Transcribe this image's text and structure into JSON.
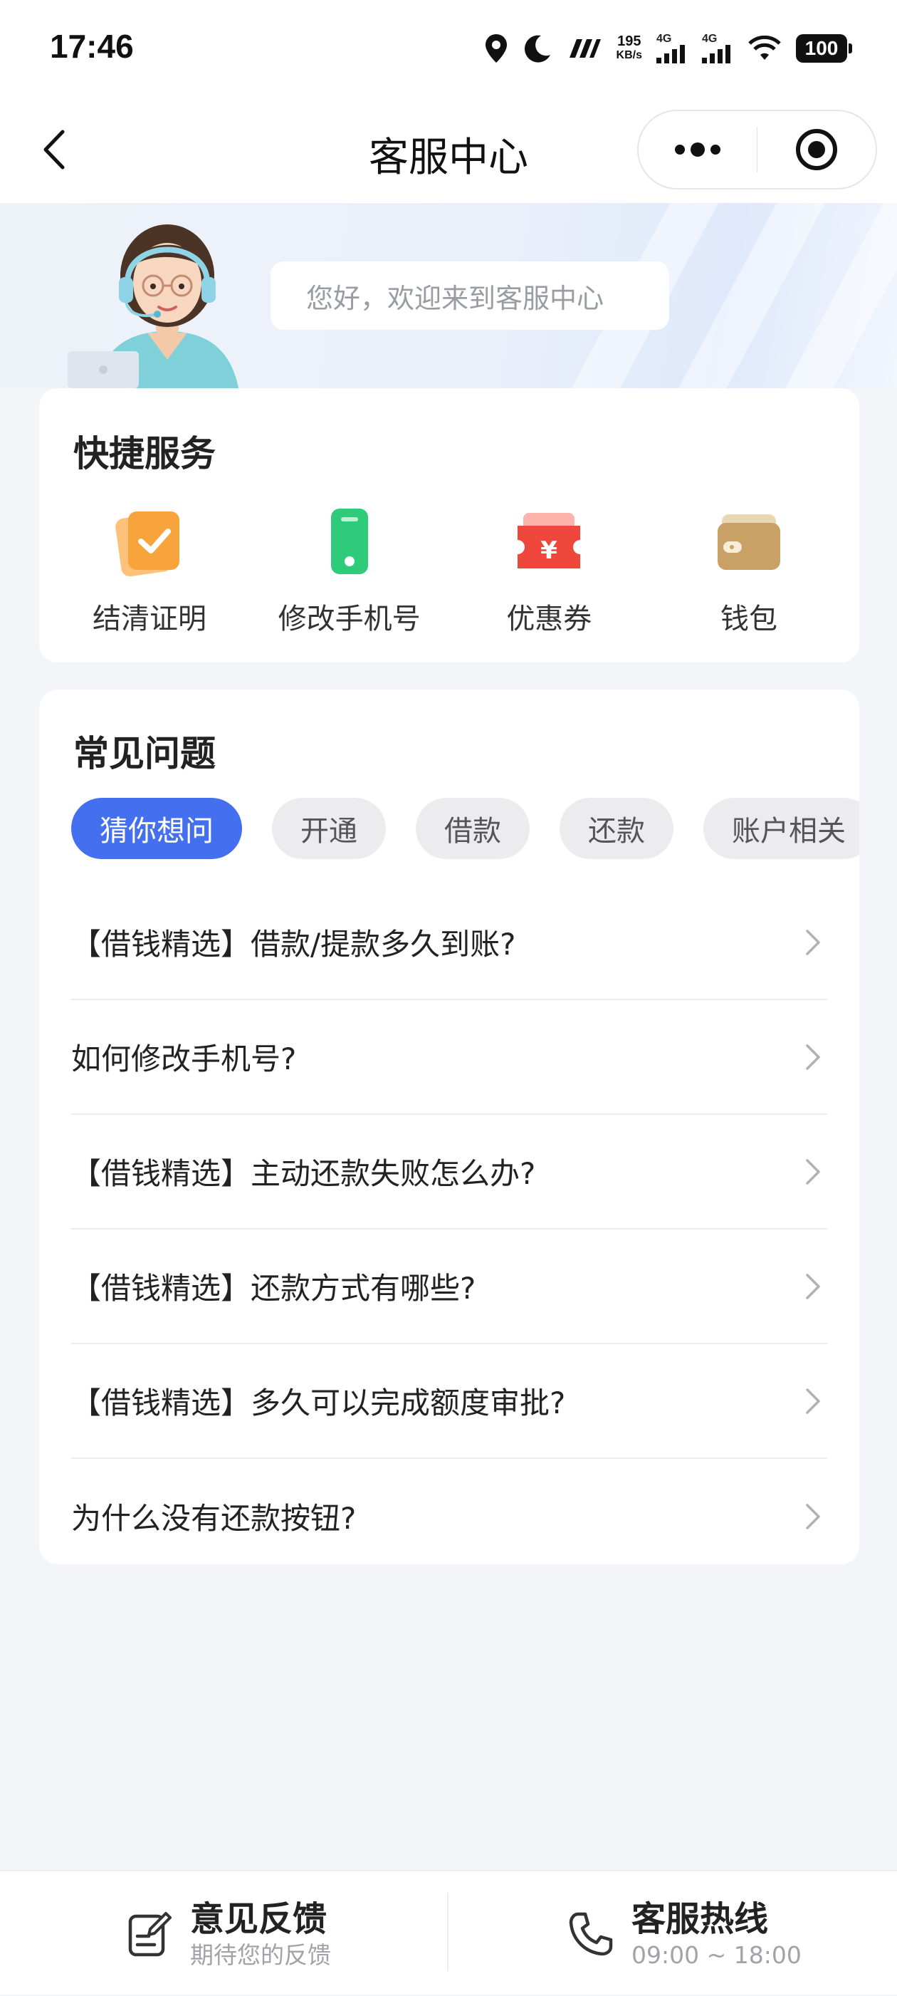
{
  "status_bar": {
    "time": "17:46",
    "net_speed_value": "195",
    "net_speed_unit": "KB/s",
    "sim1_label": "4G",
    "sim2_label": "4G",
    "battery": "100"
  },
  "nav": {
    "title": "客服中心"
  },
  "hero": {
    "greeting": "您好，欢迎来到客服中心"
  },
  "quick_services": {
    "title": "快捷服务",
    "items": [
      {
        "label": "结清证明",
        "icon": "certificate-check-icon",
        "color": "#f5a23c"
      },
      {
        "label": "修改手机号",
        "icon": "phone-icon",
        "color": "#2ecb7a"
      },
      {
        "label": "优惠券",
        "icon": "coupon-icon",
        "color": "#f0473d"
      },
      {
        "label": "钱包",
        "icon": "wallet-icon",
        "color": "#c9a066"
      }
    ]
  },
  "faq": {
    "title": "常见问题",
    "chips": [
      "猜你想问",
      "开通",
      "借款",
      "还款",
      "账户相关"
    ],
    "active_chip": "猜你想问",
    "questions": [
      "【借钱精选】借款/提款多久到账?",
      "如何修改手机号?",
      "【借钱精选】主动还款失败怎么办?",
      "【借钱精选】还款方式有哪些?",
      "【借钱精选】多久可以完成额度审批?",
      "为什么没有还款按钮?"
    ]
  },
  "bottom_bar": {
    "feedback": {
      "title": "意见反馈",
      "subtitle": "期待您的反馈"
    },
    "hotline": {
      "title": "客服热线",
      "subtitle": "09:00 ~ 18:00"
    }
  },
  "colors": {
    "accent": "#4470f0",
    "background": "#f4f5f9"
  }
}
